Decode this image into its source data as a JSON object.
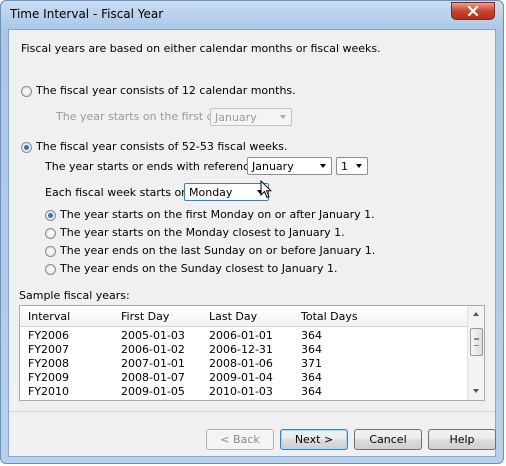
{
  "window": {
    "title": "Time Interval - Fiscal Year"
  },
  "intro_text": "Fiscal years are based on either calendar months or fiscal weeks.",
  "option_calendar": {
    "label": "The fiscal year consists of 12 calendar months.",
    "selected": false,
    "start_label": "The year starts on the first day of",
    "month_value": "January"
  },
  "option_weeks": {
    "label": "The fiscal year consists of 52-53 fiscal weeks.",
    "selected": true,
    "reference_label": "The year starts or ends with reference to",
    "reference_month": "January",
    "reference_day": "1",
    "week_start_label": "Each fiscal week starts on a",
    "week_start_day": "Monday",
    "rules": [
      {
        "label": "The year starts on the first Monday on or after January 1.",
        "selected": true
      },
      {
        "label": "The year starts on the Monday closest to January 1.",
        "selected": false
      },
      {
        "label": "The year ends on the last Sunday on or before January 1.",
        "selected": false
      },
      {
        "label": "The year ends on the Sunday closest to January 1.",
        "selected": false
      }
    ]
  },
  "sample": {
    "label": "Sample fiscal years:",
    "columns": [
      "Interval",
      "First Day",
      "Last Day",
      "Total Days"
    ],
    "rows": [
      [
        "FY2006",
        "2005-01-03",
        "2006-01-01",
        "364"
      ],
      [
        "FY2007",
        "2006-01-02",
        "2006-12-31",
        "364"
      ],
      [
        "FY2008",
        "2007-01-01",
        "2008-01-06",
        "371"
      ],
      [
        "FY2009",
        "2008-01-07",
        "2009-01-04",
        "364"
      ],
      [
        "FY2010",
        "2009-01-05",
        "2010-01-03",
        "364"
      ]
    ]
  },
  "buttons": {
    "back": "< Back",
    "next": "Next >",
    "cancel": "Cancel",
    "help": "Help"
  },
  "colors": {
    "accent": "#3c7fb1",
    "close": "#c6452b",
    "radio_dot": "#3a6fc0"
  }
}
